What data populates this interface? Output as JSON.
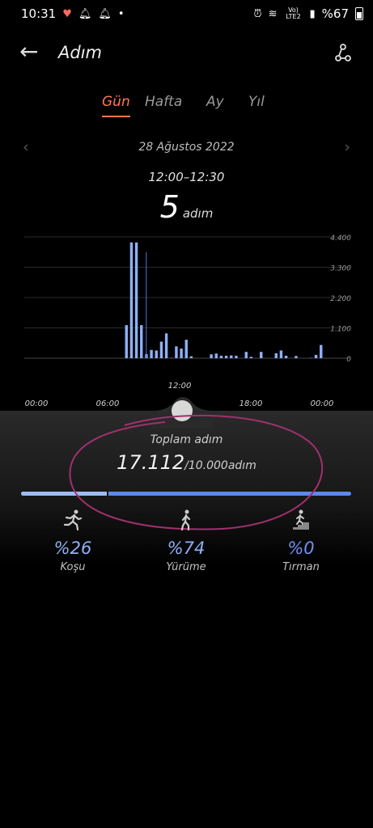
{
  "status": {
    "time": "10:31",
    "network": "Vo) LTE2",
    "battery": "%67"
  },
  "header": {
    "title": "Adım"
  },
  "tabs": [
    {
      "label": "Gün",
      "active": true
    },
    {
      "label": "Hafta",
      "active": false
    },
    {
      "label": "Ay",
      "active": false
    },
    {
      "label": "Yıl",
      "active": false
    }
  ],
  "date": "28 Ağustos 2022",
  "selection": {
    "time_range": "12:00–12:30",
    "steps": "5",
    "unit": "adım"
  },
  "chart_data": {
    "type": "bar",
    "x_ticks": [
      "00:00",
      "06:00",
      "12:00",
      "18:00",
      "00:00"
    ],
    "y_ticks": [
      "4.400",
      "3.300",
      "2.200",
      "1.100",
      "0"
    ],
    "ylim": [
      0,
      4400
    ],
    "selected_slot": 24,
    "values": [
      0,
      0,
      0,
      0,
      0,
      0,
      0,
      0,
      0,
      0,
      0,
      0,
      0,
      0,
      0,
      0,
      0,
      0,
      0,
      0,
      1200,
      4200,
      4200,
      1200,
      150,
      300,
      280,
      600,
      900,
      10,
      430,
      350,
      670,
      70,
      0,
      0,
      0,
      140,
      170,
      90,
      90,
      100,
      90,
      0,
      230,
      50,
      0,
      230,
      0,
      0,
      180,
      280,
      90,
      0,
      80,
      0,
      0,
      10,
      120,
      480
    ]
  },
  "total": {
    "label": "Toplam adım",
    "value": "17.112",
    "goal": "/10.000adım",
    "progress_fraction": 1.0,
    "first_segment_fraction": 0.26
  },
  "activities": [
    {
      "key": "run",
      "percent": "%26",
      "label": "Koşu"
    },
    {
      "key": "walk",
      "percent": "%74",
      "label": "Yürüme"
    },
    {
      "key": "climb",
      "percent": "%0",
      "label": "Tırman"
    }
  ],
  "colors": {
    "accent_tab": "#ff7a52",
    "bar": "#8fb0f7",
    "progress": "#5b8ae8",
    "annotation": "#a0306e"
  }
}
